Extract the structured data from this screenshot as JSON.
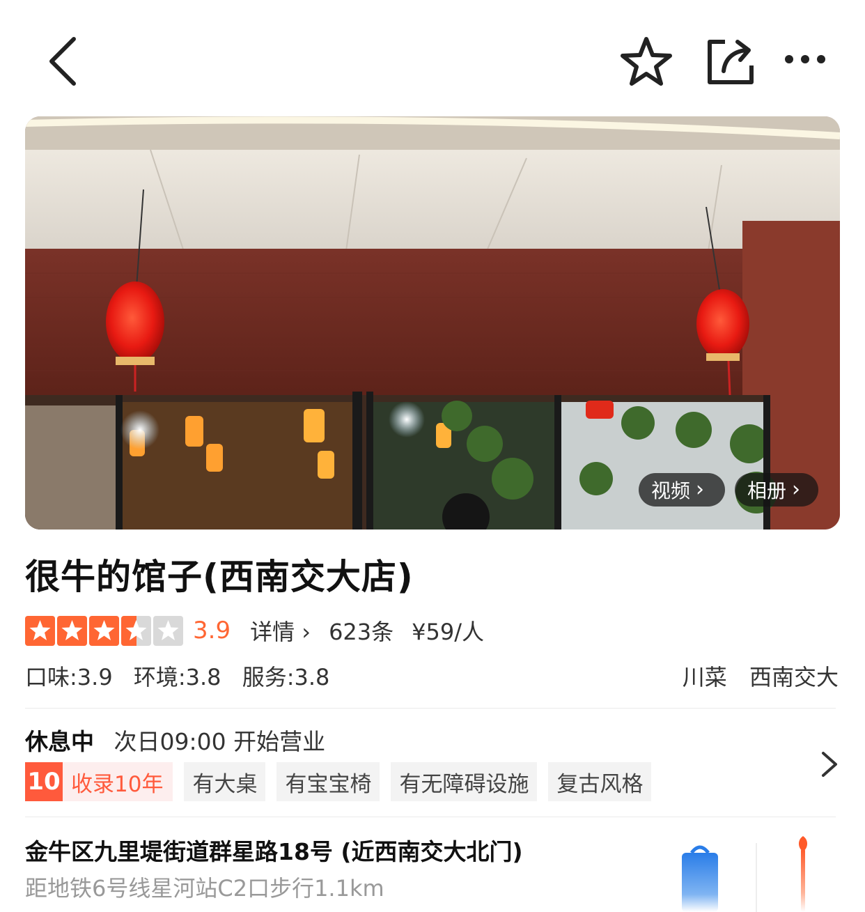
{
  "header": {
    "back_icon": "chevron-left-icon",
    "favorite_icon": "star-outline-icon",
    "share_icon": "share-icon",
    "more_icon": "more-horizontal-icon"
  },
  "hero": {
    "video_label": "视频",
    "album_label": "相册"
  },
  "shop": {
    "name": "很牛的馆子(西南交大店)",
    "rating": 3.5,
    "score_text": "3.9",
    "details_label": "详情",
    "review_count": "623条",
    "price": "¥59/人",
    "subscores": [
      "口味:3.9",
      "环境:3.8",
      "服务:3.8"
    ],
    "categories": [
      "川菜",
      "西南交大"
    ]
  },
  "status": {
    "state": "休息中",
    "next_open": "次日09:00 开始营业"
  },
  "chips": {
    "years_badge": "10",
    "years_label": "收录10年",
    "items": [
      "有大桌",
      "有宝宝椅",
      "有无障碍设施",
      "复古风格"
    ]
  },
  "address": {
    "text": "金牛区九里堤街道群星路18号 (近西南交大北门)",
    "metro": "距地铁6号线星河站C2口步行1.1km"
  },
  "colors": {
    "accent": "#ff6633",
    "star_empty": "#d9d9d9",
    "badge_red": "#ff5a3c"
  }
}
